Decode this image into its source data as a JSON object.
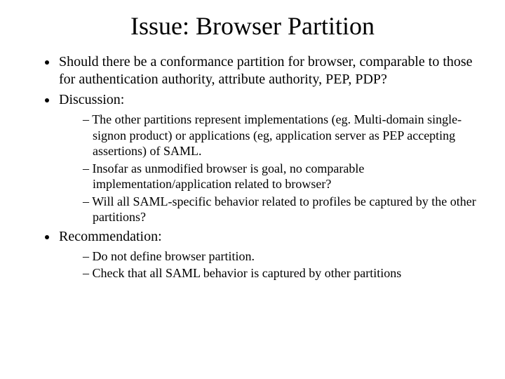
{
  "title": "Issue: Browser Partition",
  "bullets": {
    "b1": "Should there be a conformance partition for browser, comparable to those for authentication authority, attribute authority, PEP, PDP?",
    "b2": "Discussion:",
    "b2_sub": {
      "s1": "The other partitions represent implementations (eg. Multi-domain single-signon product) or applications (eg, application server as PEP accepting assertions) of SAML.",
      "s2": "Insofar as unmodified browser is goal, no comparable implementation/application related to browser?",
      "s3": "Will all SAML-specific behavior related to profiles be captured by the other partitions?"
    },
    "b3": "Recommendation:",
    "b3_sub": {
      "s1": "Do not define browser partition.",
      "s2": "Check that all SAML behavior is captured by other partitions"
    }
  }
}
